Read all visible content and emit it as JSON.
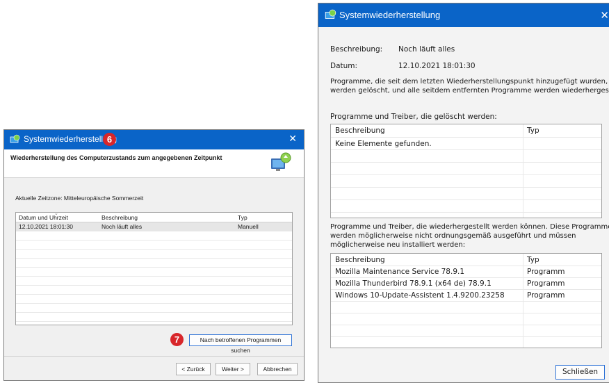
{
  "left_window": {
    "title": "Systemwiederherstellung",
    "badge_top": "6",
    "header_text": "Wiederherstellung des Computerzustands zum angegebenen Zeitpunkt",
    "timezone": "Aktuelle Zeitzone: Mitteleuropäische Sommerzeit",
    "columns": [
      "Datum und Uhrzeit",
      "Beschreibung",
      "Typ"
    ],
    "rows": [
      {
        "date": "12.10.2021 18:01:30",
        "description": "Noch läuft alles",
        "type": "Manuell"
      }
    ],
    "badge_scan": "7",
    "scan_button": "Nach betroffenen Programmen suchen",
    "back_button": "< Zurück",
    "next_button": "Weiter >",
    "cancel_button": "Abbrechen"
  },
  "right_window": {
    "title": "Systemwiederherstellung",
    "description_label": "Beschreibung:",
    "description_value": "Noch läuft alles",
    "date_label": "Datum:",
    "date_value": "12.10.2021 18:01:30",
    "info_line1": "Programme, die seit dem letzten Wiederherstellungspunkt hinzugefügt wurden,",
    "info_line2": "werden gelöscht, und alle seitdem entfernten Programme werden wiederhergestellt.",
    "deleted_heading": "Programme und Treiber, die gelöscht werden:",
    "deleted_columns": [
      "Beschreibung",
      "Typ"
    ],
    "deleted_empty": "Keine Elemente gefunden.",
    "restored_heading_line1": "Programme und Treiber, die wiederhergestellt werden können. Diese Programme",
    "restored_heading_line2": "werden möglicherweise nicht ordnungsgemäß ausgeführt und müssen",
    "restored_heading_line3": "möglicherweise neu installiert werden:",
    "restored_columns": [
      "Beschreibung",
      "Typ"
    ],
    "restored_rows": [
      {
        "description": "Mozilla Maintenance Service 78.9.1",
        "type": "Programm"
      },
      {
        "description": "Mozilla Thunderbird 78.9.1 (x64 de) 78.9.1",
        "type": "Programm"
      },
      {
        "description": "Windows 10-Update-Assistent 1.4.9200.23258",
        "type": "Programm"
      }
    ],
    "close_button": "Schließen"
  },
  "colors": {
    "titlebar": "#0a64c8",
    "badge": "#d8262a"
  }
}
